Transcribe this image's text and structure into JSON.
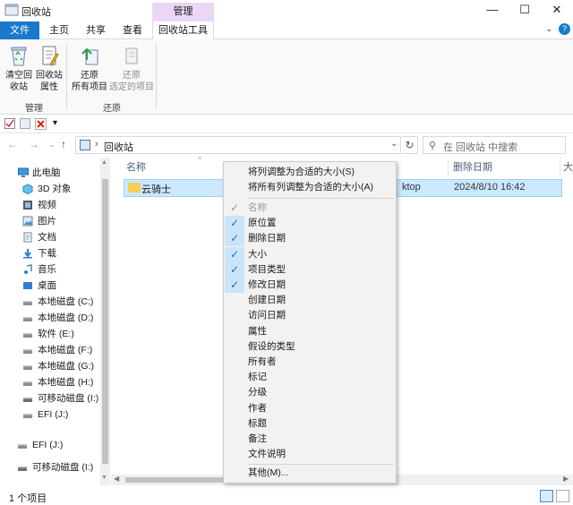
{
  "window": {
    "title": "回收站",
    "context_tab": "管理",
    "controls": {
      "minimize": "—",
      "maximize": "☐",
      "close": "✕"
    }
  },
  "ribbon": {
    "tabs": [
      "文件",
      "主页",
      "共享",
      "查看",
      "回收站工具"
    ],
    "groups": {
      "manage": {
        "label": "管理",
        "buttons": [
          "清空回\n收站",
          "回收站\n属性"
        ]
      },
      "restore": {
        "label": "还原",
        "buttons": [
          "还原\n所有项目",
          "还原\n选定的项目"
        ]
      }
    }
  },
  "qat": {
    "dropdown": "▾"
  },
  "address": {
    "path": "回收站",
    "search_placeholder": "在 回收站 中搜索"
  },
  "sidebar": {
    "items": [
      {
        "label": "此电脑",
        "icon": "pc-icon"
      },
      {
        "label": "3D 对象",
        "icon": "3d-objects-icon"
      },
      {
        "label": "视频",
        "icon": "video-icon"
      },
      {
        "label": "图片",
        "icon": "pictures-icon"
      },
      {
        "label": "文档",
        "icon": "documents-icon"
      },
      {
        "label": "下载",
        "icon": "downloads-icon"
      },
      {
        "label": "音乐",
        "icon": "music-icon"
      },
      {
        "label": "桌面",
        "icon": "desktop-icon"
      },
      {
        "label": "本地磁盘 (C:)",
        "icon": "drive-icon"
      },
      {
        "label": "本地磁盘 (D:)",
        "icon": "drive-icon"
      },
      {
        "label": "软件 (E:)",
        "icon": "drive-icon"
      },
      {
        "label": "本地磁盘 (F:)",
        "icon": "drive-icon"
      },
      {
        "label": "本地磁盘 (G:)",
        "icon": "drive-icon"
      },
      {
        "label": "本地磁盘 (H:)",
        "icon": "drive-icon"
      },
      {
        "label": "可移动磁盘 (I:)",
        "icon": "removable-drive-icon"
      },
      {
        "label": "EFI (J:)",
        "icon": "drive-icon"
      },
      {
        "label": "EFI (J:)",
        "icon": "drive-icon"
      },
      {
        "label": "可移动磁盘 (I:)",
        "icon": "removable-drive-icon"
      }
    ]
  },
  "list": {
    "columns": [
      "名称",
      "删除日期",
      "大"
    ],
    "rows": [
      {
        "name": "云骑士",
        "location": "ktop",
        "deleted": "2024/8/10 16:42"
      }
    ]
  },
  "context_menu": {
    "top_items": [
      "将列调整为合适的大小(S)",
      "将所有列调整为合适的大小(A)"
    ],
    "columns": [
      {
        "label": "名称",
        "checked": true,
        "disabled": true
      },
      {
        "label": "原位置",
        "checked": true,
        "disabled": false
      },
      {
        "label": "删除日期",
        "checked": true,
        "disabled": false
      },
      {
        "label": "大小",
        "checked": true,
        "disabled": false
      },
      {
        "label": "项目类型",
        "checked": true,
        "disabled": false
      },
      {
        "label": "修改日期",
        "checked": true,
        "disabled": false
      },
      {
        "label": "创建日期",
        "checked": false,
        "disabled": false
      },
      {
        "label": "访问日期",
        "checked": false,
        "disabled": false
      },
      {
        "label": "属性",
        "checked": false,
        "disabled": false
      },
      {
        "label": "假设的类型",
        "checked": false,
        "disabled": false
      },
      {
        "label": "所有者",
        "checked": false,
        "disabled": false
      },
      {
        "label": "标记",
        "checked": false,
        "disabled": false
      },
      {
        "label": "分级",
        "checked": false,
        "disabled": false
      },
      {
        "label": "作者",
        "checked": false,
        "disabled": false
      },
      {
        "label": "标题",
        "checked": false,
        "disabled": false
      },
      {
        "label": "备注",
        "checked": false,
        "disabled": false
      },
      {
        "label": "文件说明",
        "checked": false,
        "disabled": false
      }
    ],
    "more": "其他(M)..."
  },
  "status": {
    "count": "1 个项目"
  },
  "colors": {
    "accent": "#1979ca",
    "context_tab": "#ecd7f3",
    "selection": "#cce8ff",
    "menu_check_bg": "#cce4f7"
  }
}
